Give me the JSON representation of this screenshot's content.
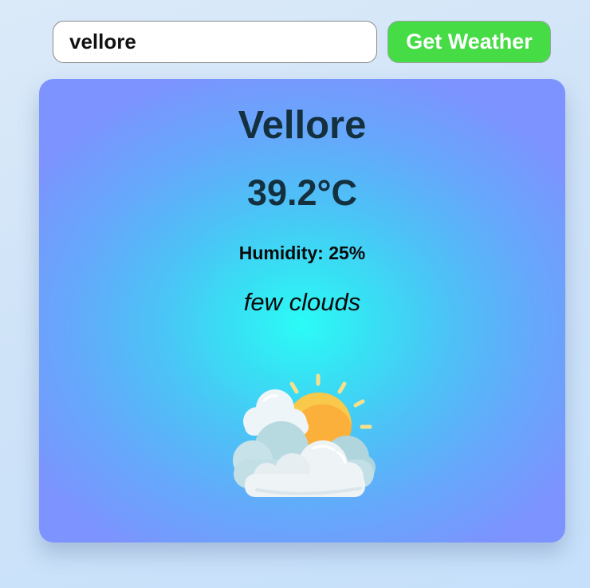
{
  "search": {
    "value": "vellore",
    "button_label": "Get Weather"
  },
  "weather": {
    "city": "Vellore",
    "temperature": "39.2°C",
    "humidity": "Humidity: 25%",
    "description": "few clouds",
    "icon": "few-clouds-icon"
  },
  "colors": {
    "button": "#45dc45",
    "card_center": "#2bfbf6",
    "card_edge": "#7d93ff",
    "text_dark": "#14303f"
  }
}
